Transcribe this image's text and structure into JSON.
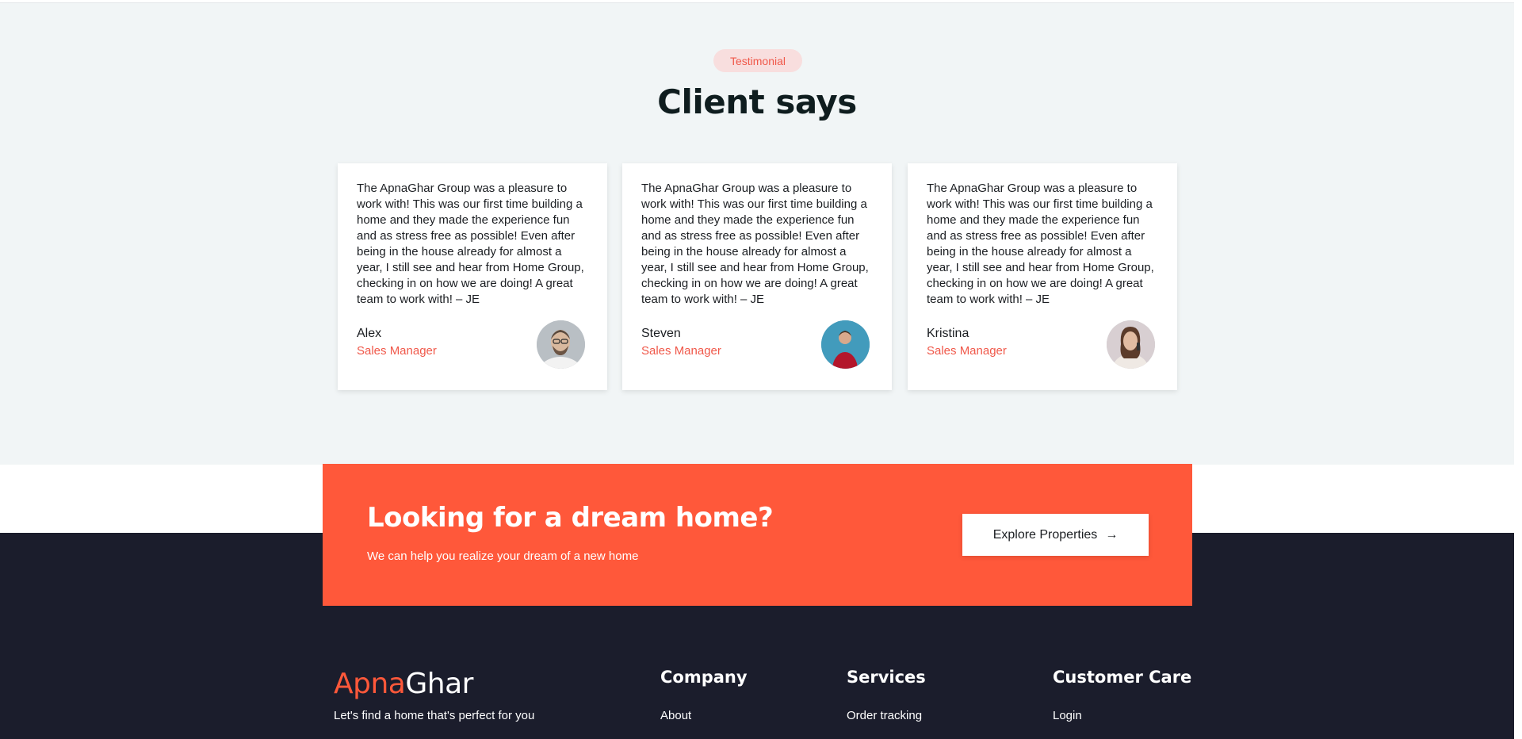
{
  "testimonials": {
    "badge": "Testimonial",
    "title": "Client says",
    "cards": [
      {
        "text": "The ApnaGhar Group was a pleasure to work with! This was our first time building a home and they made the experience fun and as stress free as possible! Even after being in the house already for almost a year, I still see and hear from Home Group, checking in on how we are doing! A great team to work with! – JE",
        "name": "Alex",
        "role": "Sales Manager"
      },
      {
        "text": "The ApnaGhar Group was a pleasure to work with! This was our first time building a home and they made the experience fun and as stress free as possible! Even after being in the house already for almost a year, I still see and hear from Home Group, checking in on how we are doing! A great team to work with! – JE",
        "name": "Steven",
        "role": "Sales Manager"
      },
      {
        "text": "The ApnaGhar Group was a pleasure to work with! This was our first time building a home and they made the experience fun and as stress free as possible! Even after being in the house already for almost a year, I still see and hear from Home Group, checking in on how we are doing! A great team to work with! – JE",
        "name": "Kristina",
        "role": "Sales Manager"
      }
    ]
  },
  "cta": {
    "title": "Looking for a dream home?",
    "subtitle": "We can help you realize your dream of a new home",
    "button_label": "Explore Properties",
    "button_icon": "arrow-right-icon"
  },
  "footer": {
    "brand_accent": "Apna",
    "brand_rest": "Ghar",
    "tagline": "Let's find a home that's perfect for you",
    "columns": [
      {
        "heading": "Company",
        "first_link": "About"
      },
      {
        "heading": "Services",
        "first_link": "Order tracking"
      },
      {
        "heading": "Customer Care",
        "first_link": "Login"
      }
    ]
  },
  "colors": {
    "accent": "#ff583a",
    "section_bg": "#f1f5f6",
    "footer_bg": "#1b1d2c",
    "role_text": "#f0584a"
  }
}
